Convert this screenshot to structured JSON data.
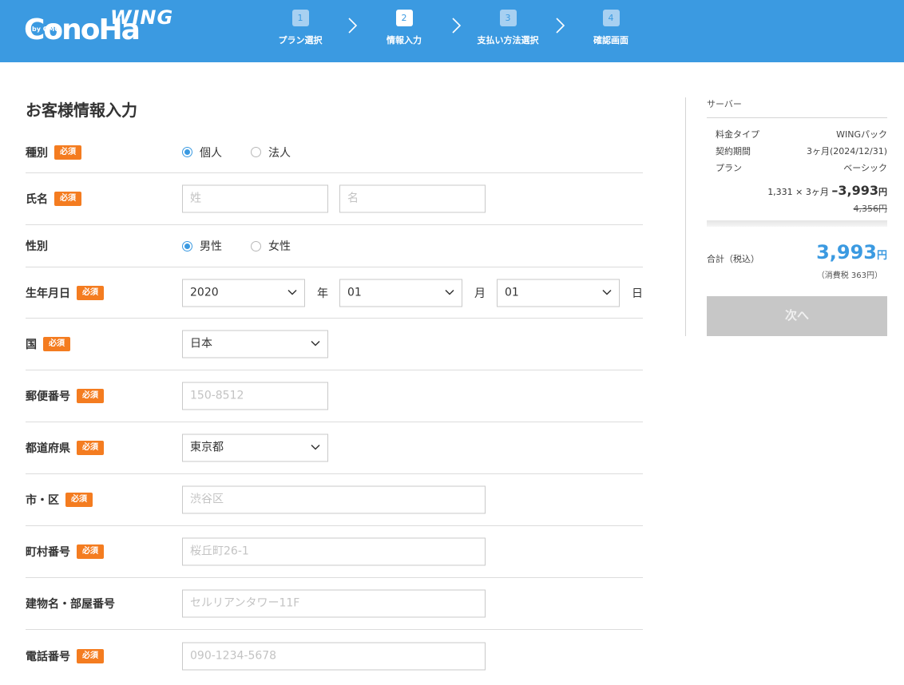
{
  "header": {
    "logo_text": "ConoHa",
    "logo_by": "by GMO",
    "logo_wing": "WING",
    "steps": [
      {
        "num": "1",
        "label": "プラン選択",
        "state": "inactive"
      },
      {
        "num": "2",
        "label": "情報入力",
        "state": "active"
      },
      {
        "num": "3",
        "label": "支払い方法選択",
        "state": "inactive"
      },
      {
        "num": "4",
        "label": "確認画面",
        "state": "inactive"
      }
    ]
  },
  "form": {
    "title": "お客様情報入力",
    "required_badge": "必須",
    "type": {
      "label": "種別",
      "options": [
        "個人",
        "法人"
      ],
      "selected": "個人"
    },
    "name": {
      "label": "氏名",
      "last_placeholder": "姓",
      "first_placeholder": "名"
    },
    "gender": {
      "label": "性別",
      "options": [
        "男性",
        "女性"
      ],
      "selected": "男性"
    },
    "birth": {
      "label": "生年月日",
      "year": "2020",
      "year_unit": "年",
      "month": "01",
      "month_unit": "月",
      "day": "01",
      "day_unit": "日"
    },
    "country": {
      "label": "国",
      "value": "日本"
    },
    "postal": {
      "label": "郵便番号",
      "placeholder": "150-8512"
    },
    "prefecture": {
      "label": "都道府県",
      "value": "東京都"
    },
    "city": {
      "label": "市・区",
      "placeholder": "渋谷区"
    },
    "town": {
      "label": "町村番号",
      "placeholder": "桜丘町26-1"
    },
    "building": {
      "label": "建物名・部屋番号",
      "placeholder": "セルリアンタワー11F"
    },
    "phone": {
      "label": "電話番号",
      "placeholder": "090-1234-5678"
    }
  },
  "sidebar": {
    "heading": "サーバー",
    "rows": [
      {
        "key": "料金タイプ",
        "value": "WINGパック"
      },
      {
        "key": "契約期間",
        "value": "3ヶ月(2024/12/31)"
      },
      {
        "key": "プラン",
        "value": "ベーシック"
      }
    ],
    "calc_prefix": "1,331 × 3ヶ月",
    "calc_amount": "–3,993",
    "calc_yen": "円",
    "original_price": "4,356円",
    "total_label": "合計（税込）",
    "total_amount": "3,993",
    "total_yen": "円",
    "tax_note": "（消費税 363円）",
    "next_label": "次へ"
  },
  "colors": {
    "brand_blue": "#3b9ae1",
    "required_orange": "#f47c20",
    "disabled_gray": "#c7c7c7"
  }
}
